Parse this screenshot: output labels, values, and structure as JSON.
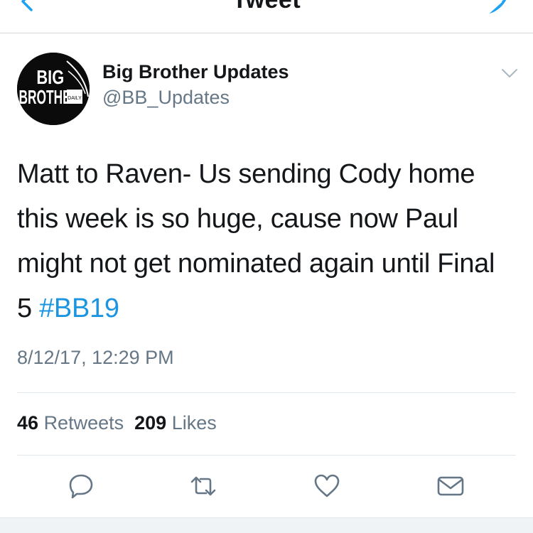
{
  "nav": {
    "title": "Tweet",
    "back_icon": "chevron-left-icon",
    "compose_icon": "compose-feather-icon",
    "accent_color": "#1da1f2"
  },
  "tweet": {
    "avatar": {
      "logo_lines": [
        "BIG",
        "BROTHER",
        "DAILY"
      ]
    },
    "display_name": "Big Brother Updates",
    "handle": "@BB_Updates",
    "text": "Matt to Raven- Us sending Cody home this week is so huge, cause now Paul might not get nominated again until Final 5 ",
    "hashtag": "#BB19",
    "timestamp": "8/12/17, 12:29 PM",
    "retweet_count": "46",
    "retweet_label": "Retweets",
    "like_count": "209",
    "like_label": "Likes",
    "hashtag_color": "#1b95e0"
  },
  "actions": [
    {
      "name": "reply",
      "icon": "reply-bubble-icon"
    },
    {
      "name": "retweet",
      "icon": "retweet-icon"
    },
    {
      "name": "like",
      "icon": "heart-icon"
    },
    {
      "name": "share",
      "icon": "envelope-icon"
    }
  ]
}
